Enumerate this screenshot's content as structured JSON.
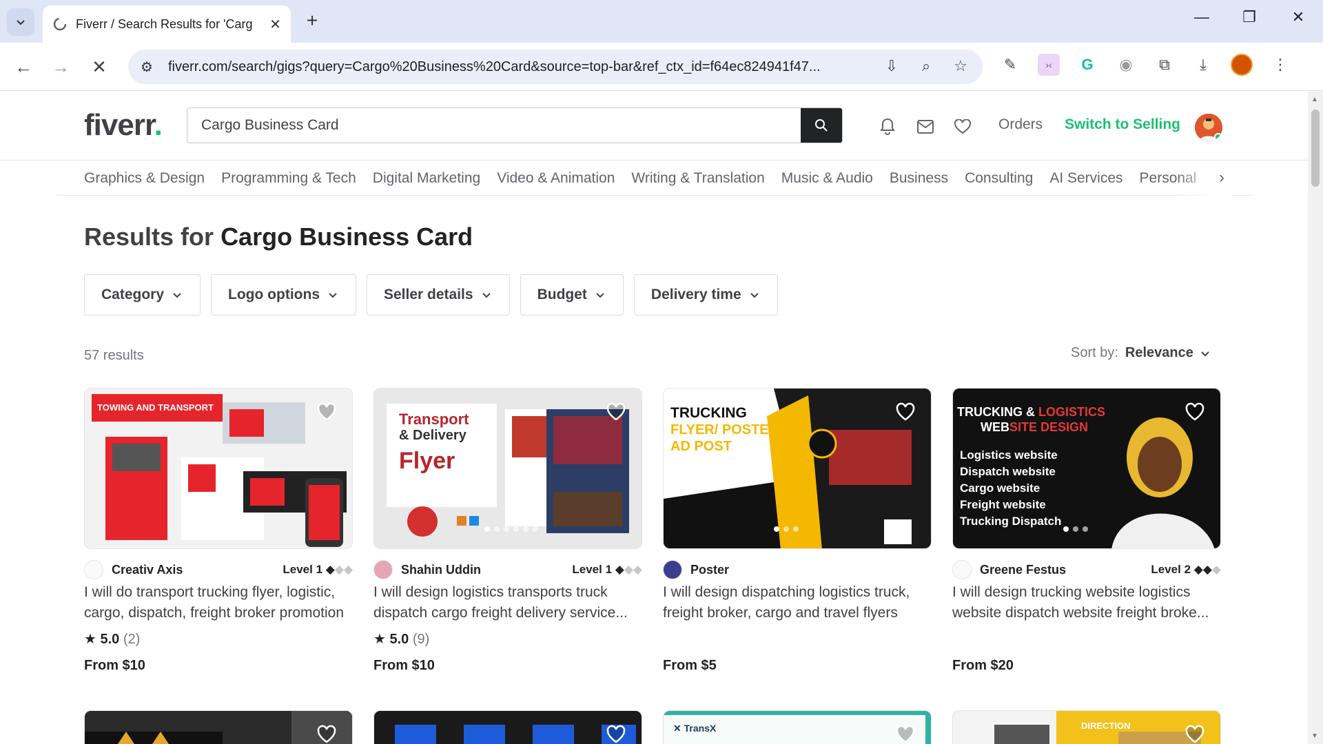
{
  "browser": {
    "tab_title": "Fiverr / Search Results for 'Carg",
    "url": "fiverr.com/search/gigs?query=Cargo%20Business%20Card&source=top-bar&ref_ctx_id=f64ec824941f47..."
  },
  "header": {
    "logo_text": "fiverr",
    "logo_dot": ".",
    "search_value": "Cargo Business Card",
    "orders_label": "Orders",
    "switch_label": "Switch to Selling"
  },
  "categories": [
    "Graphics & Design",
    "Programming & Tech",
    "Digital Marketing",
    "Video & Animation",
    "Writing & Translation",
    "Music & Audio",
    "Business",
    "Consulting",
    "AI Services",
    "Personal"
  ],
  "results": {
    "prefix": "Results for",
    "query": "Cargo Business Card",
    "count": "57 results",
    "sort_label": "Sort by:",
    "sort_value": "Relevance"
  },
  "filters": [
    "Category",
    "Logo options",
    "Seller details",
    "Budget",
    "Delivery time"
  ],
  "gigs": [
    {
      "seller": "Creativ Axis",
      "level": "Level 1",
      "level_on": "◆",
      "level_off": "◆◆",
      "desc": "I will do transport trucking flyer, logistic, cargo, dispatch, freight broker promotion",
      "rating": "5.0",
      "reviews": "(2)",
      "price": "From $10",
      "img_text": "TOWING AND TRANSPORT"
    },
    {
      "seller": "Shahin Uddin",
      "level": "Level 1",
      "level_on": "◆",
      "level_off": "◆◆",
      "desc": "I will design logistics transports truck dispatch cargo freight delivery service...",
      "rating": "5.0",
      "reviews": "(9)",
      "price": "From $10",
      "img_text_1": "Transport",
      "img_text_2": "& Delivery",
      "img_text_3": "Flyer"
    },
    {
      "seller": "Poster",
      "level": "",
      "desc": "I will design dispatching logistics truck, freight broker, cargo and travel flyers",
      "rating": "",
      "reviews": "",
      "price": "From $5",
      "img_text_1": "TRUCKING",
      "img_text_2": "FLYER/ POSTER",
      "img_text_3": "AD POST"
    },
    {
      "seller": "Greene Festus",
      "level": "Level 2",
      "level_on": "◆◆",
      "level_off": "◆",
      "desc": "I will design trucking website logistics website dispatch website freight broke...",
      "rating": "",
      "reviews": "",
      "price": "From $20",
      "img_title": "TRUCKING & LOGISTICS WEBSITE DESIGN",
      "img_bullets": [
        "Logistics website",
        "Dispatch website",
        "Cargo website",
        "Freight website",
        "Trucking Dispatch"
      ]
    }
  ],
  "colors": {
    "brand_green": "#1dbf73",
    "text_dark": "#222325",
    "text_gray": "#62646a"
  }
}
